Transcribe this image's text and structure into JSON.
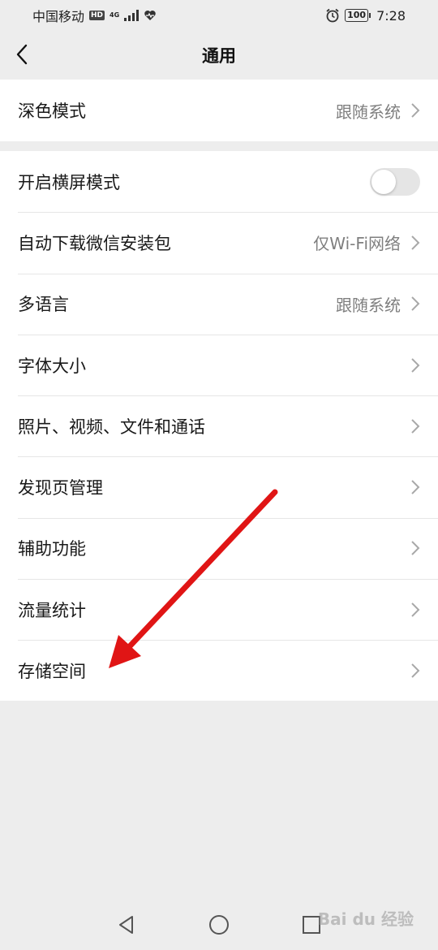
{
  "status_bar": {
    "carrier": "中国移动",
    "hd": "HD",
    "network": "4G",
    "battery": "100",
    "time": "7:28"
  },
  "header": {
    "title": "通用"
  },
  "group1": [
    {
      "label": "深色模式",
      "value": "跟随系统"
    }
  ],
  "group2": {
    "landscape": {
      "label": "开启横屏模式",
      "enabled": false
    },
    "items": [
      {
        "label": "自动下载微信安装包",
        "value": "仅Wi-Fi网络"
      },
      {
        "label": "多语言",
        "value": "跟随系统"
      },
      {
        "label": "字体大小",
        "value": ""
      },
      {
        "label": "照片、视频、文件和通话",
        "value": ""
      },
      {
        "label": "发现页管理",
        "value": ""
      },
      {
        "label": "辅助功能",
        "value": ""
      },
      {
        "label": "流量统计",
        "value": ""
      },
      {
        "label": "存储空间",
        "value": ""
      }
    ]
  },
  "annotation": {
    "arrow_color": "#e01515"
  },
  "watermark": "Bai du 经验"
}
